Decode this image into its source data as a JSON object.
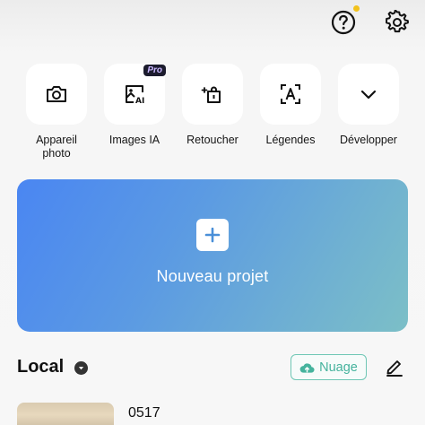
{
  "header": {
    "help_icon": "question-circle-icon",
    "settings_icon": "gear-icon",
    "notification_dot_color": "#f2c21c"
  },
  "tools": [
    {
      "label": "Appareil\nphoto",
      "icon": "camera-icon"
    },
    {
      "label": "Images IA",
      "icon": "ai-image-icon",
      "badge": "Pro"
    },
    {
      "label": "Retoucher",
      "icon": "retouch-icon"
    },
    {
      "label": "Légendes",
      "icon": "captions-icon"
    },
    {
      "label": "Développer",
      "icon": "chevron-down-icon"
    }
  ],
  "new_project": {
    "label": "Nouveau projet",
    "icon": "plus-icon"
  },
  "local": {
    "title": "Local",
    "cloud_label": "Nuage",
    "cloud_icon": "cloud-upload-icon",
    "edit_icon": "pencil-icon",
    "accent_color": "#45b39d"
  },
  "projects": [
    {
      "name": "0517"
    }
  ]
}
